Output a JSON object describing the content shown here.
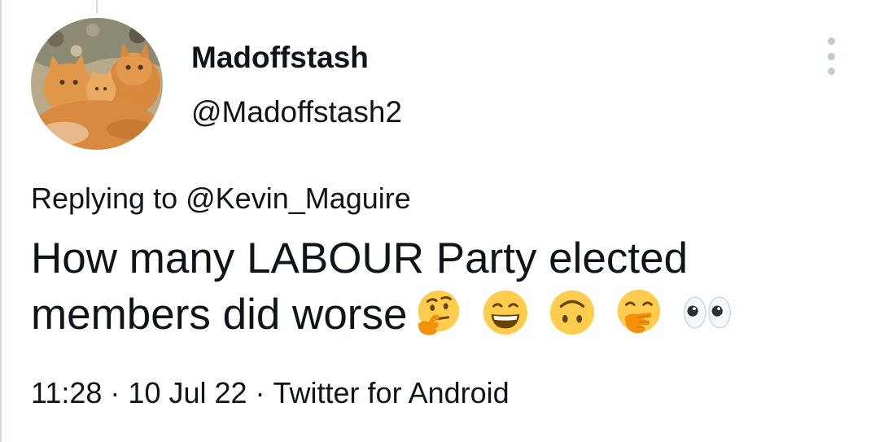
{
  "author": {
    "display_name": "Madoffstash",
    "handle": "@Madoffstash2"
  },
  "reply_context": {
    "prefix": "Replying to",
    "mention": "@Kevin_Maguire"
  },
  "tweet": {
    "text": "How many LABOUR Party elected members did worse",
    "emojis": [
      "thinking-face",
      "grinning-squinting-face",
      "upside-down-face",
      "face-with-hand-over-mouth",
      "eyes"
    ]
  },
  "meta": {
    "time": "11:28",
    "date": "10 Jul 22",
    "source": "Twitter for Android",
    "separator": "·"
  },
  "icons": {
    "more": "more-vertical-icon"
  },
  "colors": {
    "text": "#0f1419",
    "divider": "#cfd9de",
    "emoji_yellow": "#ffcc4d",
    "emoji_orange": "#f4900c"
  }
}
